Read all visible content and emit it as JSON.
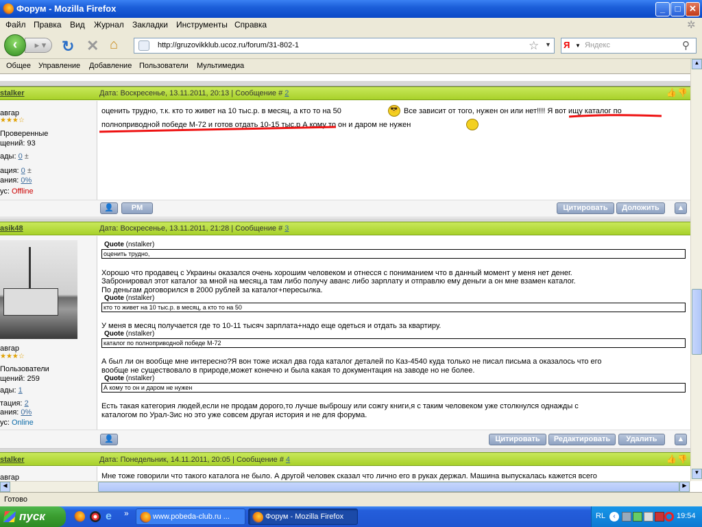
{
  "window": {
    "title": "Форум - Mozilla Firefox",
    "min": "_",
    "max": "□",
    "close": "✕"
  },
  "menu": {
    "file": "Файл",
    "edit": "Правка",
    "view": "Вид",
    "history": "Журнал",
    "bookmarks": "Закладки",
    "tools": "Инструменты",
    "help": "Справка"
  },
  "nav": {
    "url": "http://gruzovikklub.ucoz.ru/forum/31-802-1",
    "search_placeholder": "Яндекс",
    "search_engine": "Я"
  },
  "bookmarks": [
    "Общее",
    "Управление",
    "Добавление",
    "Пользователи",
    "Мультимедиа"
  ],
  "posts": [
    {
      "author": "stalker",
      "date": "Дата: Воскресенье, 13.11.2011, 20:13 | Сообщение # ",
      "num": "2",
      "rank": "авгар",
      "group": "Проверенные",
      "msgs": "щений: 93",
      "awards_label": "ады:",
      "awards": "0",
      "rep_label": "ация:",
      "rep": "0",
      "warn_label": "ания:",
      "warn": "0%",
      "status_label": "ус:",
      "status": "Offline",
      "text1": "оценить трудно, т.к. кто то живет на 10 тыс.р. в месяц, а кто то на 50",
      "text2": "Все зависит от того, нужен он или нет!!!! Я вот ищу каталог по",
      "text3": "полноприводной победе М-72 и готов отдать 10-15 тыс.р А кому то он и даром не нужен"
    },
    {
      "author": "asik48",
      "date": "Дата: Воскресенье, 13.11.2011, 21:28 | Сообщение # ",
      "num": "3",
      "rank": "авгар",
      "group": "Пользователи",
      "msgs": "щений: 259",
      "awards_label": "ады:",
      "awards": "1",
      "rep_label": "тация:",
      "rep": "2",
      "warn_label": "ания:",
      "warn": "0%",
      "status_label": "ус:",
      "status": "Online",
      "quote_label": "Quote",
      "quote_author": "(nstalker)",
      "q1": "оценить трудно,",
      "p1": "Хорошо что продавец с Украины оказался очень хорошим человеком и отнесся с пониманием что в данный момент у меня нет денег.",
      "p2": "Забронировал этот каталог за мной на месяц,а там либо получу аванс либо зарплату и отправлю ему деньги а он мне взамен каталог.",
      "p3": "По деньгам договорился в 2000 рублей за каталог+пересылка.",
      "q2": "кто то живет на 10 тыс.р. в месяц, а кто то на 50",
      "p4": "У меня в месяц получается где то 10-11 тысяч зарплата+надо еще одеться и отдать за квартиру.",
      "q3": "каталог по полноприводной победе М-72",
      "p5": "А был ли он вообще мне интересно?Я вон тоже искал два года каталог деталей по Каз-4540 куда только не писал письма а оказалось что его",
      "p6": "вообще не существовало в природе,может конечно и была какая то документация на заводе но не более.",
      "q4": "А кому то он и даром не нужен",
      "p7": "Есть такая категория людей,если не продам дорого,то лучше выброшу или сожгу книги,я с таким человеком уже столкнулся однажды с",
      "p8": "каталогом по Урал-Зис но это уже совсем другая история и не для форума."
    },
    {
      "author": "stalker",
      "date": "Дата: Понедельник, 14.11.2011, 20:05 | Сообщение # ",
      "num": "4",
      "rank": "авгар",
      "text1": "Мне тоже говорили что такого каталога не было. А другой человек сказал что лично его в руках держал. Машина выпускалась кажется всего"
    }
  ],
  "buttons": {
    "pm": "PM",
    "quote": "Цитировать",
    "report": "Доложить",
    "edit": "Редактировать",
    "delete": "Удалить"
  },
  "status": "Готово",
  "taskbar": {
    "start": "пуск",
    "task1": "www.pobeda-club.ru ...",
    "task2": "Форум - Mozilla Firefox",
    "lang": "RL",
    "clock": "19:54"
  }
}
